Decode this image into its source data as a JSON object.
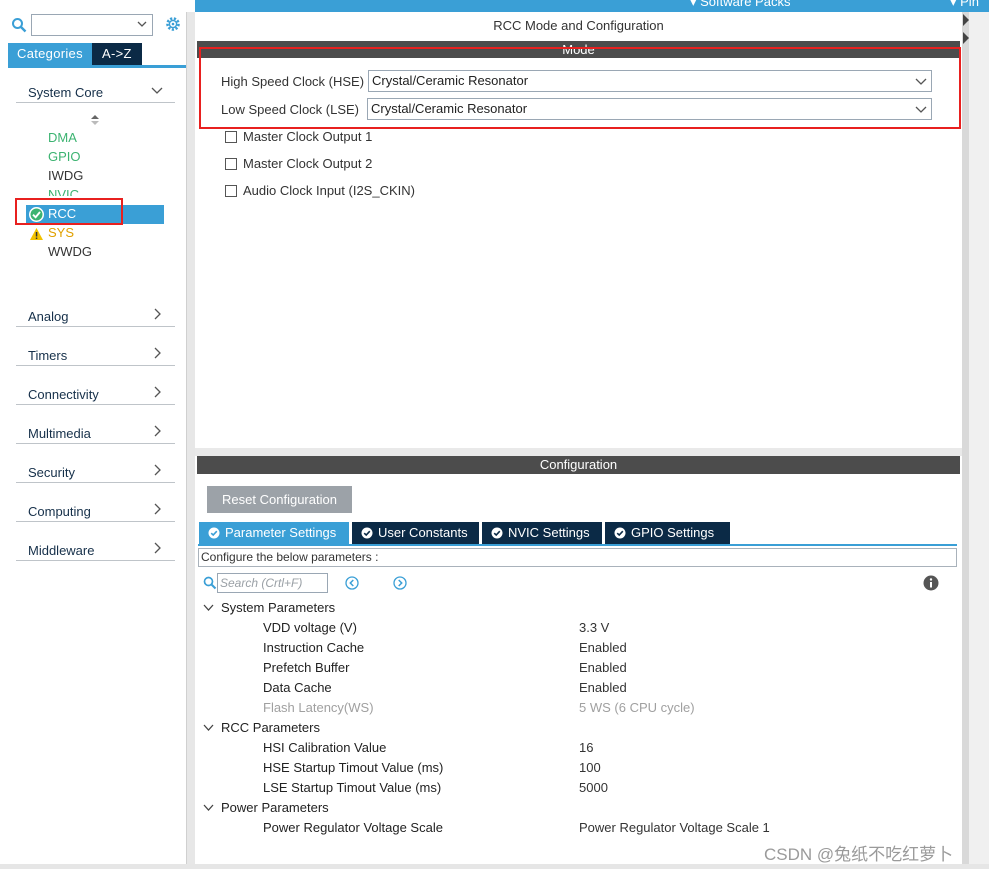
{
  "top_strip": {
    "item1": "Software Packs",
    "item2": "Pin"
  },
  "left": {
    "tabs": {
      "categories": "Categories",
      "az": "A->Z"
    },
    "system_core": "System Core",
    "system_core_items": {
      "dma": "DMA",
      "gpio": "GPIO",
      "iwdg": "IWDG",
      "nvic": "NVIC",
      "rcc": "RCC",
      "sys": "SYS",
      "wwdg": "WWDG"
    },
    "categories": {
      "analog": "Analog",
      "timers": "Timers",
      "connectivity": "Connectivity",
      "multimedia": "Multimedia",
      "security": "Security",
      "computing": "Computing",
      "middleware": "Middleware"
    }
  },
  "mode": {
    "title": "RCC Mode and Configuration",
    "section": "Mode",
    "hse_label": "High Speed Clock (HSE)",
    "hse_value": "Crystal/Ceramic Resonator",
    "lse_label": "Low Speed Clock (LSE)",
    "lse_value": "Crystal/Ceramic Resonator",
    "checkboxes": {
      "mco1": "Master Clock Output 1",
      "mco2": "Master Clock Output 2",
      "i2s": "Audio Clock Input (I2S_CKIN)"
    }
  },
  "config": {
    "section": "Configuration",
    "reset_button": "Reset Configuration",
    "tabs": {
      "parameter": "Parameter Settings",
      "user": "User Constants",
      "nvic": "NVIC Settings",
      "gpio": "GPIO Settings"
    },
    "description": "Configure the below parameters :",
    "search_placeholder": "Search (Crtl+F)",
    "groups": {
      "system": {
        "label": "System Parameters",
        "vdd_name": "VDD voltage (V)",
        "vdd_value": "3.3 V",
        "icache_name": "Instruction Cache",
        "icache_value": "Enabled",
        "prefetch_name": "Prefetch Buffer",
        "prefetch_value": "Enabled",
        "dcache_name": "Data Cache",
        "dcache_value": "Enabled",
        "flash_name": "Flash Latency(WS)",
        "flash_value": "5 WS (6 CPU cycle)"
      },
      "rcc": {
        "label": "RCC Parameters",
        "hsi_name": "HSI Calibration Value",
        "hsi_value": "16",
        "hse_name": "HSE Startup Timout Value (ms)",
        "hse_value": "100",
        "lse_name": "LSE Startup Timout Value (ms)",
        "lse_value": "5000"
      },
      "power": {
        "label": "Power Parameters",
        "regulator_name": "Power Regulator Voltage Scale",
        "regulator_value": "Power Regulator Voltage Scale 1"
      }
    }
  },
  "watermark": "CSDN @兔纸不吃红萝卜",
  "colors": {
    "accent": "#3a9fd6",
    "navy": "#0b2a46",
    "green": "#3cb371",
    "highlight_red": "#e8201f",
    "section_bar": "#4c4c4c"
  }
}
